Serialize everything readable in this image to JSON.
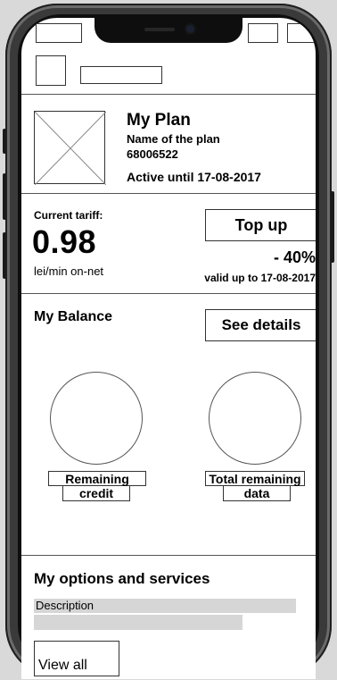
{
  "plan": {
    "title": "My Plan",
    "name": "Name of the plan",
    "number": "68006522",
    "active_until": "Active until 17-08-2017"
  },
  "tariff": {
    "label": "Current tariff:",
    "value": "0.98",
    "unit": "lei/min on-net",
    "topup_label": "Top up",
    "discount": "- 40%",
    "valid_until": "valid up to 17-08-2017"
  },
  "balance": {
    "title": "My Balance",
    "details_label": "See details",
    "gauges": [
      {
        "line1": "Remaining",
        "line2": "credit"
      },
      {
        "line1": "Total remaining",
        "line2": "data"
      }
    ]
  },
  "options": {
    "title": "My options and services",
    "description_label": "Description",
    "view_all_label": "View all"
  },
  "icons": {
    "image_placeholder": "image-placeholder-icon"
  }
}
